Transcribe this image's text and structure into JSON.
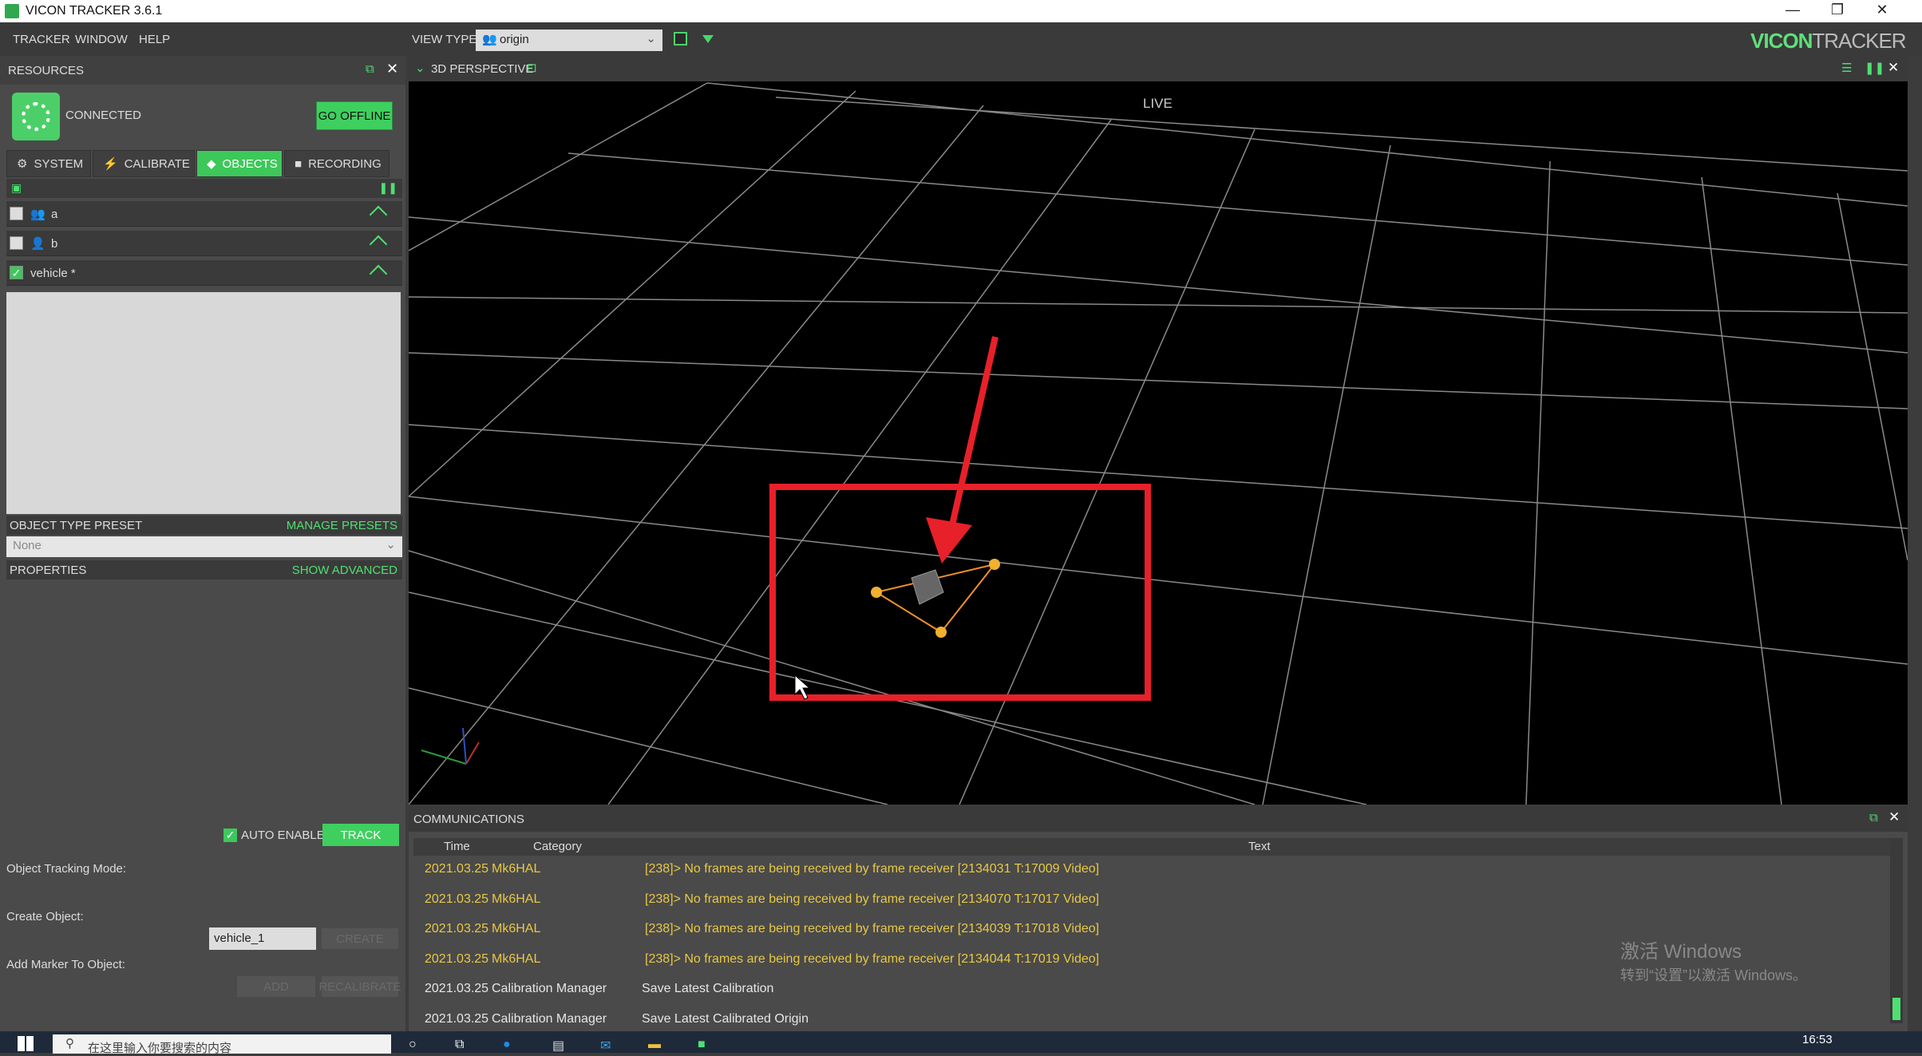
{
  "window": {
    "title": "VICON TRACKER 3.6.1"
  },
  "menu": [
    "TRACKER",
    "WINDOW",
    "HELP"
  ],
  "view_type": {
    "label": "VIEW TYPE:",
    "value": "origin"
  },
  "logo": {
    "part1": "V",
    "part2": "ICON",
    "part3": "TRACKER"
  },
  "resources": {
    "title": "RESOURCES",
    "status": "CONNECTED",
    "go_offline": "GO OFFLINE",
    "tabs": [
      "SYSTEM",
      "CALIBRATE",
      "OBJECTS",
      "RECORDING"
    ],
    "active_tab": "OBJECTS",
    "objects": [
      {
        "name": "a",
        "checked": false
      },
      {
        "name": "b",
        "checked": false
      },
      {
        "name": "vehicle *",
        "checked": true
      }
    ],
    "preset": {
      "title": "OBJECT TYPE PRESET",
      "link": "MANAGE PRESETS",
      "value": "None"
    },
    "properties": {
      "title": "PROPERTIES",
      "link": "SHOW ADVANCED"
    },
    "tracking_mode_label": "Object Tracking Mode:",
    "auto_enable": "AUTO ENABLE",
    "track": "TRACK",
    "create_label": "Create Object:",
    "create_value": "vehicle_1",
    "create_btn": "CREATE",
    "add_marker_label": "Add Marker To Object:",
    "add_btn": "ADD",
    "recalibrate_btn": "RECALIBRATE"
  },
  "view": {
    "title": "3D PERSPECTIVE",
    "status": "LIVE"
  },
  "communications": {
    "title": "COMMUNICATIONS",
    "columns": [
      "Time",
      "Category",
      "Text"
    ],
    "rows": [
      {
        "time": "2021.03.25",
        "category": "Mk6HAL",
        "text": "[238]> No frames are being received by frame receiver [2134031 T:17009 Video]",
        "warn": true
      },
      {
        "time": "2021.03.25",
        "category": "Mk6HAL",
        "text": "[238]> No frames are being received by frame receiver [2134070 T:17017 Video]",
        "warn": true
      },
      {
        "time": "2021.03.25",
        "category": "Mk6HAL",
        "text": "[238]> No frames are being received by frame receiver [2134039 T:17018 Video]",
        "warn": true
      },
      {
        "time": "2021.03.25",
        "category": "Mk6HAL",
        "text": "[238]> No frames are being received by frame receiver [2134044 T:17019 Video]",
        "warn": true
      },
      {
        "time": "2021.03.25",
        "category": "Calibration Manager",
        "text": "Save Latest Calibration",
        "warn": false
      },
      {
        "time": "2021.03.25",
        "category": "Calibration Manager",
        "text": "Save Latest Calibrated Origin",
        "warn": false
      }
    ]
  },
  "watermark": {
    "line1": "激活 Windows",
    "line2": "转到“设置”以激活 Windows。"
  },
  "taskbar": {
    "search_placeholder": "在这里输入你要搜索的内容",
    "time": "16:53"
  },
  "colors": {
    "accent": "#3fcf5f",
    "warn_text": "#e8c845",
    "annotation": "#e8202a"
  }
}
